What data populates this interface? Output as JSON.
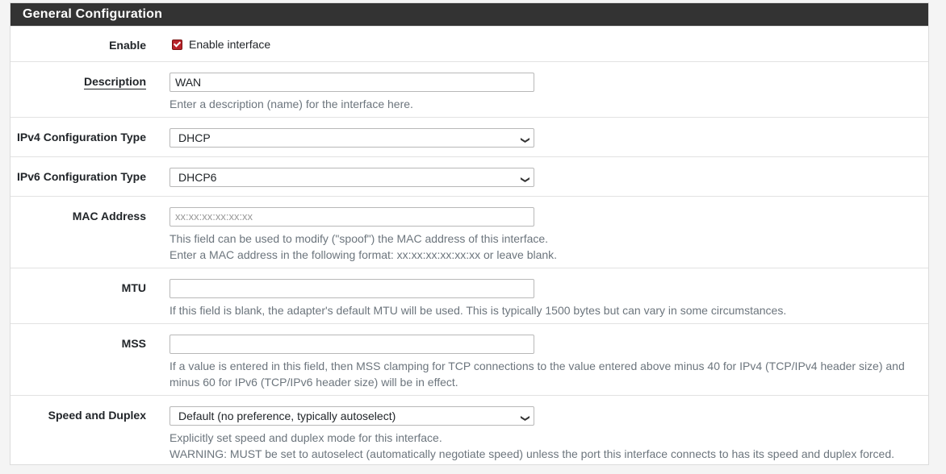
{
  "panel": {
    "title": "General Configuration"
  },
  "enable": {
    "label": "Enable",
    "checkbox_label": "Enable interface",
    "checked": true
  },
  "description": {
    "label": "Description",
    "value": "WAN",
    "help": "Enter a description (name) for the interface here."
  },
  "ipv4": {
    "label": "IPv4 Configuration Type",
    "value": "DHCP"
  },
  "ipv6": {
    "label": "IPv6 Configuration Type",
    "value": "DHCP6"
  },
  "mac": {
    "label": "MAC Address",
    "placeholder": "xx:xx:xx:xx:xx:xx",
    "help1": "This field can be used to modify (\"spoof\") the MAC address of this interface.",
    "help2": "Enter a MAC address in the following format: xx:xx:xx:xx:xx:xx or leave blank."
  },
  "mtu": {
    "label": "MTU",
    "value": "",
    "help": "If this field is blank, the adapter's default MTU will be used. This is typically 1500 bytes but can vary in some circumstances."
  },
  "mss": {
    "label": "MSS",
    "value": "",
    "help1": "If a value is entered in this field, then MSS clamping for TCP connections to the value entered above minus 40 for IPv4 (TCP/IPv4 header size) and",
    "help2": "minus 60 for IPv6 (TCP/IPv6 header size) will be in effect."
  },
  "speed": {
    "label": "Speed and Duplex",
    "value": "Default (no preference, typically autoselect)",
    "help1": "Explicitly set speed and duplex mode for this interface.",
    "help2": "WARNING: MUST be set to autoselect (automatically negotiate speed) unless the port this interface connects to has its speed and duplex forced."
  },
  "icons": {
    "select_arrow": "chevron-down-icon",
    "check": "checkmark-icon"
  },
  "colors": {
    "header_bg": "#333333",
    "checkbox": "#b8232a",
    "help_text": "#6c757d"
  }
}
